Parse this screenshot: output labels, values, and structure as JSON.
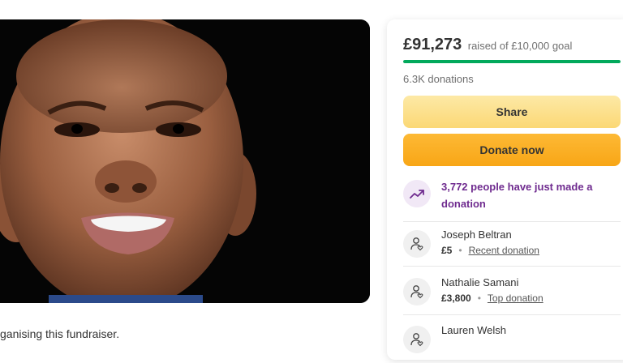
{
  "campaign": {
    "image_alt": "Photo of smiling child",
    "organiser_text": "ganising this fundraiser."
  },
  "donation_panel": {
    "raised_amount": "£91,273",
    "goal_text": "raised of £10,000 goal",
    "progress_fraction": 1.0,
    "donations_count": "6.3K donations",
    "share_label": "Share",
    "donate_label": "Donate now",
    "trend_text": "3,772 people have just made a donation",
    "donors": [
      {
        "name": "Joseph Beltran",
        "amount": "£5",
        "tag": "Recent donation"
      },
      {
        "name": "Nathalie Samani",
        "amount": "£3,800",
        "tag": "Top donation"
      },
      {
        "name": "Lauren Welsh",
        "amount": "",
        "tag": ""
      }
    ]
  },
  "colors": {
    "progress": "#02a95c",
    "donate_button": "#f8a616",
    "share_button": "#fbd875",
    "trend_text": "#6f2b8f"
  },
  "icons": {
    "trend": "trending-up-icon",
    "donor": "user-heart-icon"
  }
}
